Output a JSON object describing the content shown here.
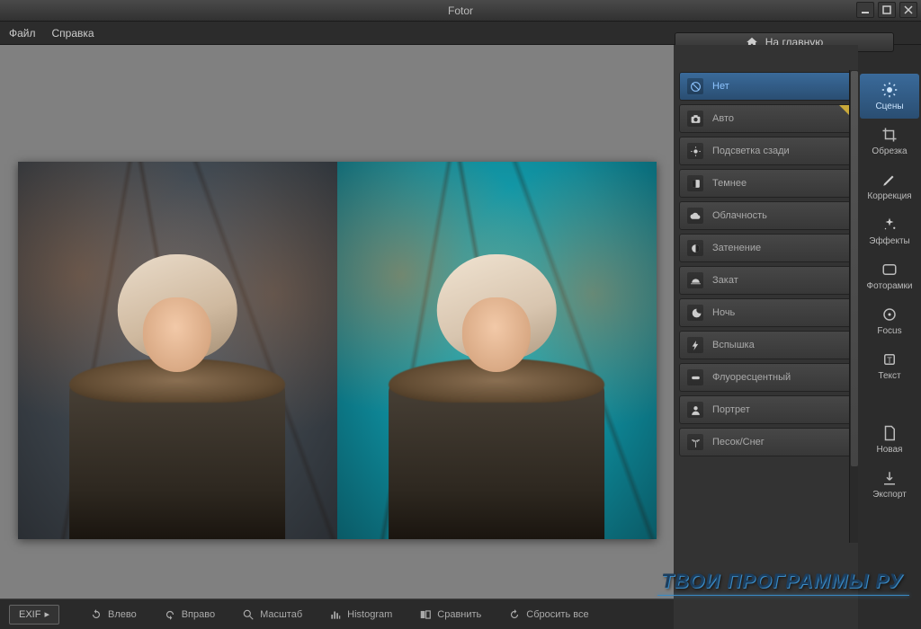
{
  "app": {
    "title": "Fotor"
  },
  "menu": {
    "file": "Файл",
    "help": "Справка"
  },
  "home_button": "На главную",
  "scenes": [
    {
      "label": "Нет",
      "icon": "ban",
      "selected": true
    },
    {
      "label": "Авто",
      "icon": "camera",
      "star": true
    },
    {
      "label": "Подсветка сзади",
      "icon": "backlight"
    },
    {
      "label": "Темнее",
      "icon": "darken"
    },
    {
      "label": "Облачность",
      "icon": "cloud"
    },
    {
      "label": "Затенение",
      "icon": "shade"
    },
    {
      "label": "Закат",
      "icon": "sunset"
    },
    {
      "label": "Ночь",
      "icon": "moon"
    },
    {
      "label": "Вспышка",
      "icon": "flash"
    },
    {
      "label": "Флуоресцентный",
      "icon": "fluor"
    },
    {
      "label": "Портрет",
      "icon": "portrait"
    },
    {
      "label": "Песок/Снег",
      "icon": "palm"
    }
  ],
  "tools": [
    {
      "label": "Сцены",
      "icon": "sun",
      "selected": true
    },
    {
      "label": "Обрезка",
      "icon": "crop"
    },
    {
      "label": "Коррекция",
      "icon": "pencil"
    },
    {
      "label": "Эффекты",
      "icon": "sparkle"
    },
    {
      "label": "Фоторамки",
      "icon": "frame"
    },
    {
      "label": "Focus",
      "icon": "target"
    },
    {
      "label": "Текст",
      "icon": "text"
    }
  ],
  "tools_bottom": [
    {
      "label": "Новая",
      "icon": "doc"
    },
    {
      "label": "Экспорт",
      "icon": "export"
    }
  ],
  "bottombar": {
    "exif": "EXIF",
    "items": [
      {
        "label": "Влево",
        "icon": "rotate-left"
      },
      {
        "label": "Вправо",
        "icon": "rotate-right"
      },
      {
        "label": "Масштаб",
        "icon": "zoom"
      },
      {
        "label": "Histogram",
        "icon": "histogram"
      },
      {
        "label": "Сравнить",
        "icon": "compare"
      },
      {
        "label": "Сбросить все",
        "icon": "reset"
      }
    ]
  },
  "watermark": "ТВОИ ПРОГРАММЫ РУ"
}
